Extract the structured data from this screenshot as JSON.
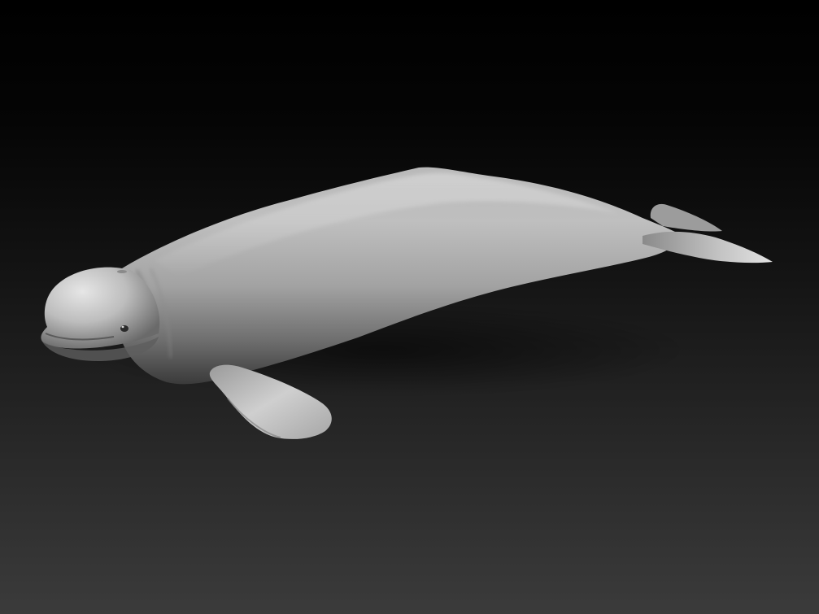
{
  "scene": {
    "subject": "beluga-whale-sculpt",
    "background_top_color": "#000000",
    "background_bottom_color": "#3b3b3b",
    "material_light_color": "#d4d4d4",
    "material_mid_color": "#8f8f8f",
    "material_dark_color": "#3c3c3c"
  }
}
